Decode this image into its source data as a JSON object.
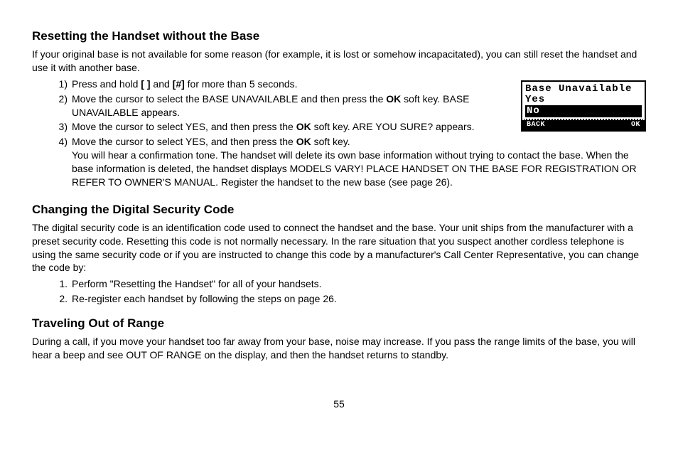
{
  "page_number": "55",
  "sections": [
    {
      "heading": "Resetting the Handset without the Base",
      "intro": "If your original base is not available for some reason (for example, it is lost or somehow incapacitated), you can still reset the handset and use it with another base.",
      "list_type": "paren",
      "items": [
        {
          "pre": "Press and hold ",
          "b1": "[ ]",
          "mid": " and ",
          "b2": "[#]",
          "post": " for more than 5 seconds."
        },
        {
          "pre": "Move the cursor to select the BASE UNAVAILABLE and then press the ",
          "b1": "OK",
          "post": " soft key. BASE UNAVAILABLE appears."
        },
        {
          "pre": "Move the cursor to select YES, and then press the ",
          "b1": "OK",
          "post": " soft key. ARE YOU SURE? appears."
        },
        {
          "pre": "Move the cursor to select YES, and then press the ",
          "b1": "OK",
          "post": " soft key.",
          "extra": "You will hear a confirmation tone. The handset will delete its own base information without trying to contact the base. When the base information is deleted, the handset displays MODELS VARY! PLACE HANDSET ON THE BASE FOR REGISTRATION OR REFER TO OWNER'S MANUAL. Register the handset to the new base (see page 26)."
        }
      ]
    },
    {
      "heading": "Changing the Digital Security Code",
      "intro": "The digital security code is an identification code used to connect the handset and the base. Your unit ships from the manufacturer with a preset security code. Resetting this code is not normally necessary. In the rare situation that you suspect another cordless telephone is using the same security code or if you are instructed to change this code by a manufacturer's Call Center Representative, you can change the code by:",
      "list_type": "dot",
      "items": [
        {
          "pre": "Perform \"Resetting the Handset\" for all of your handsets."
        },
        {
          "pre": "Re-register each handset by following the steps on page 26."
        }
      ]
    },
    {
      "heading": "Traveling Out of Range",
      "intro": "During a call, if you move your handset too far away from your base, noise may increase. If you pass the range limits of the base, you will hear a beep and see OUT OF RANGE on the display, and then the handset returns to standby."
    }
  ],
  "lcd": {
    "line1": "Base Unavailable",
    "line2": "Yes",
    "line3": "No",
    "soft_left": "BACK",
    "soft_right": "OK"
  }
}
